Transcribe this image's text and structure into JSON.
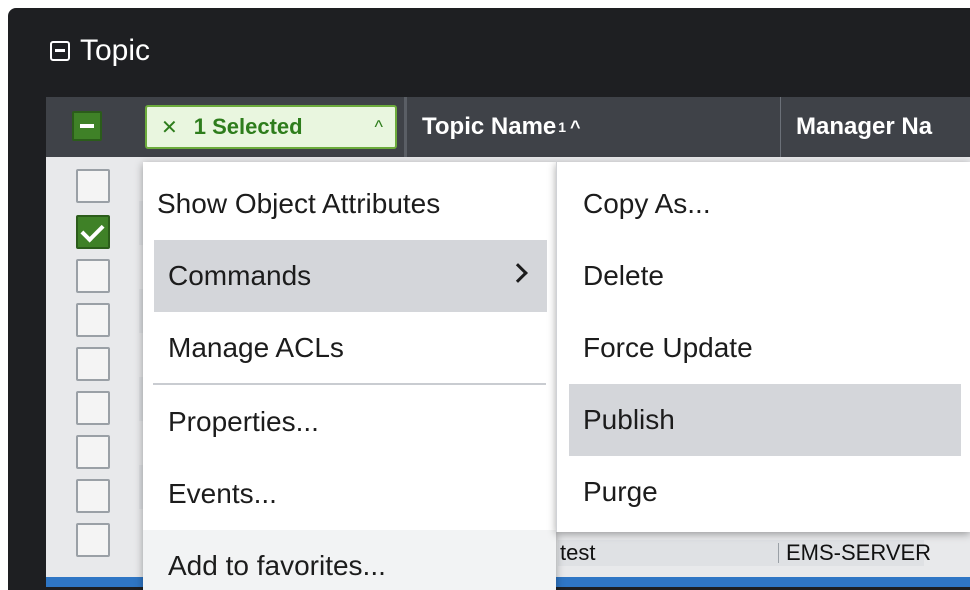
{
  "window": {
    "title": "Topic"
  },
  "table": {
    "selection_chip": {
      "clear_glyph": "✕",
      "label": "1 Selected",
      "caret_glyph": "^"
    },
    "columns": [
      {
        "label": "Topic Name",
        "sort_index": "1",
        "sort_glyph": "^"
      },
      {
        "label": "Manager Na"
      }
    ],
    "rows_checked": [
      false,
      true,
      false,
      false,
      false,
      false,
      false,
      false,
      false
    ],
    "visible_row": {
      "topic_name": "test",
      "manager_name": "EMS-SERVER"
    }
  },
  "context_menu": {
    "items": [
      {
        "label": "Show Object Attributes",
        "highlighted": false
      },
      {
        "label": "Commands",
        "highlighted": true,
        "has_submenu": true
      },
      {
        "label": "Manage ACLs",
        "highlighted": false
      },
      {
        "label": "Properties...",
        "highlighted": false
      },
      {
        "label": "Events...",
        "highlighted": false
      },
      {
        "label": "Add to favorites...",
        "highlighted": false
      }
    ]
  },
  "commands_submenu": {
    "items": [
      {
        "label": "Copy As...",
        "highlighted": false
      },
      {
        "label": "Delete",
        "highlighted": false
      },
      {
        "label": "Force Update",
        "highlighted": false
      },
      {
        "label": "Publish",
        "highlighted": true
      },
      {
        "label": "Purge",
        "highlighted": false
      }
    ]
  },
  "colors": {
    "accent_green": "#3f8127",
    "header_bg": "#3f4248",
    "menu_highlight": "#d4d6da",
    "status_bar_blue": "#2f76c5"
  }
}
